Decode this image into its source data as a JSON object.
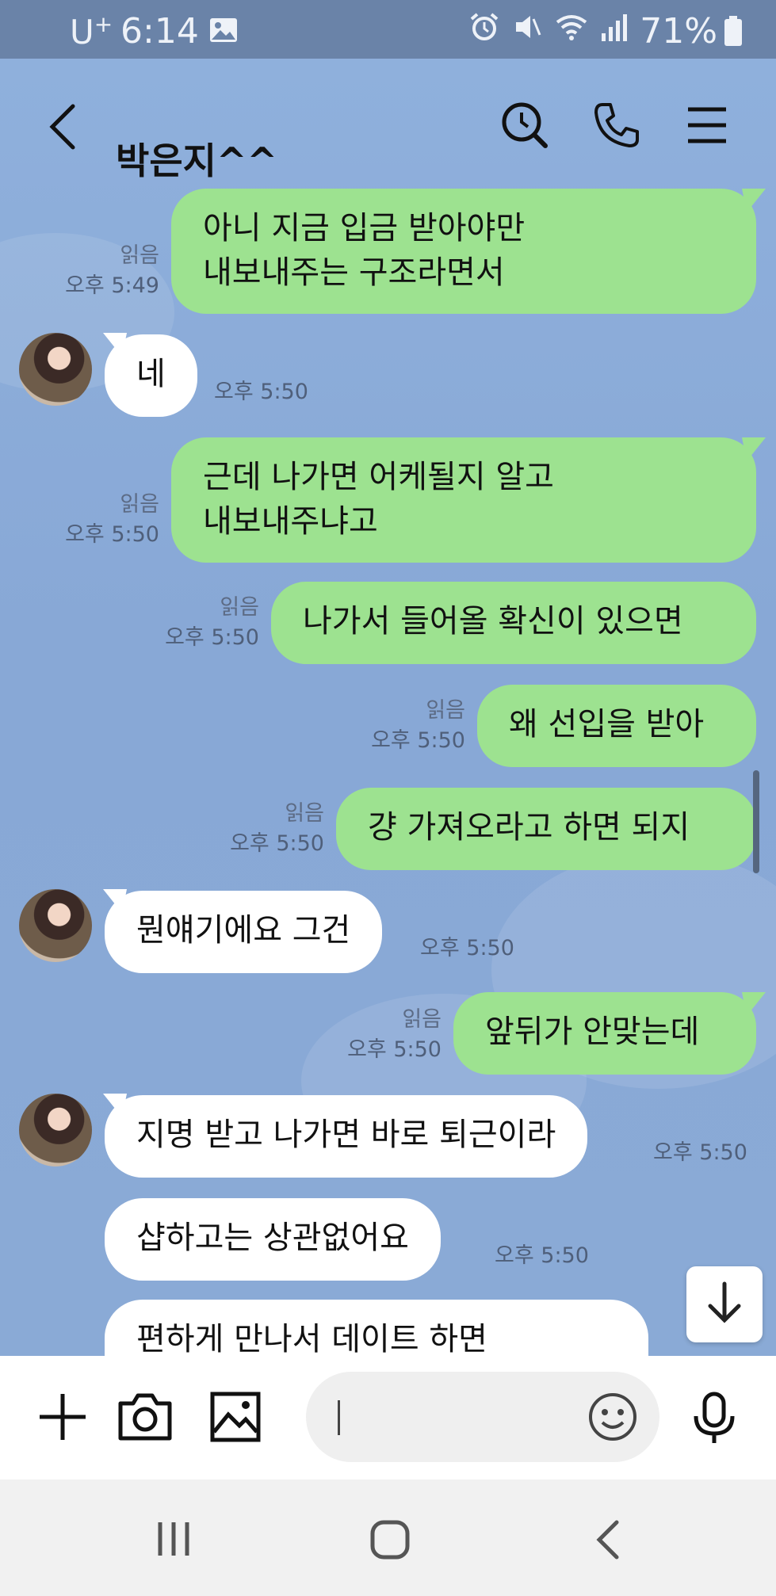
{
  "status_bar": {
    "carrier": "U",
    "carrier_plus": "+",
    "time": "6:14",
    "battery_percent": "71%",
    "icons": [
      "gallery-icon",
      "alarm-icon",
      "mute-icon",
      "wifi-icon",
      "signal-icon",
      "battery-icon"
    ]
  },
  "header": {
    "title": "박은지^^",
    "icons": [
      "back-icon",
      "search-icon",
      "call-icon",
      "menu-icon"
    ]
  },
  "messages": [
    {
      "sender": "me",
      "lines": [
        "아니 지금 입금 받아야만",
        "내보내주는 구조라면서"
      ],
      "read": "읽음",
      "time": "오후 5:49"
    },
    {
      "sender": "them",
      "lines": [
        "네"
      ],
      "time": "오후 5:50"
    },
    {
      "sender": "me",
      "lines": [
        "근데 나가면 어케될지 알고",
        "내보내주냐고"
      ],
      "read": "읽음",
      "time": "오후 5:50"
    },
    {
      "sender": "me",
      "lines": [
        "나가서 들어올 확신이 있으면"
      ],
      "read": "읽음",
      "time": "오후 5:50"
    },
    {
      "sender": "me",
      "lines": [
        "왜 선입을 받아"
      ],
      "read": "읽음",
      "time": "오후 5:50"
    },
    {
      "sender": "me",
      "lines": [
        "걍 가져오라고 하면 되지"
      ],
      "read": "읽음",
      "time": "오후 5:50"
    },
    {
      "sender": "them",
      "lines": [
        "뭔얘기에요 그건"
      ],
      "time": "오후 5:50"
    },
    {
      "sender": "me",
      "lines": [
        "앞뒤가 안맞는데"
      ],
      "read": "읽음",
      "time": "오후 5:50"
    },
    {
      "sender": "them",
      "lines": [
        "지명 받고 나가면 바로 퇴근이라"
      ],
      "time": "오후 5:50"
    },
    {
      "sender": "them",
      "lines": [
        "샵하고는 상관없어요"
      ],
      "time": "오후 5:50"
    },
    {
      "sender": "them",
      "lines": [
        "편하게 만나서 데이트 하면"
      ],
      "time": ""
    }
  ],
  "input_bar": {
    "icons": [
      "plus-icon",
      "camera-icon",
      "image-icon",
      "emoji-icon",
      "mic-icon"
    ],
    "value": ""
  },
  "nav_bar": {
    "icons": [
      "recent-apps-icon",
      "home-icon",
      "back-nav-icon"
    ]
  },
  "colors": {
    "my_bubble": "#9de290",
    "their_bubble": "#ffffff",
    "chat_background": "#8eadd9",
    "status_bar": "#6a83a8"
  }
}
